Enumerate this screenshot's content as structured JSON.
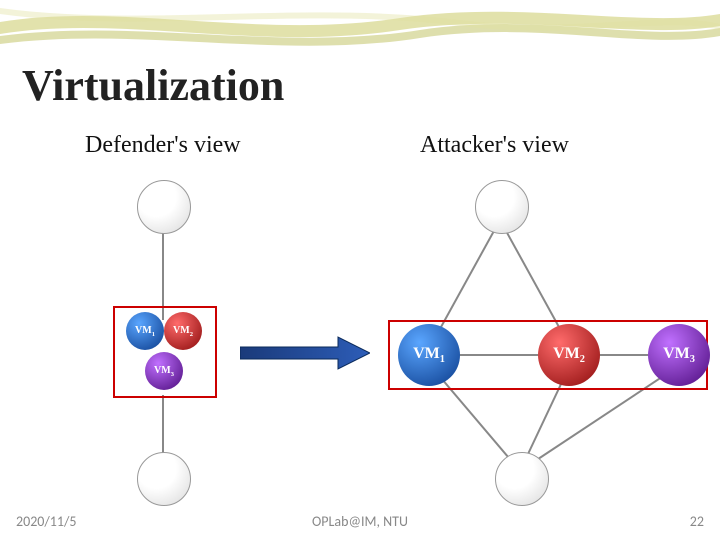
{
  "slide": {
    "title": "Virtualization",
    "defender_label": "Defender's view",
    "attacker_label": "Attacker's view"
  },
  "vms": {
    "vm1_html": "VM<sub>1</sub>",
    "vm2_html": "VM<sub>2</sub>",
    "vm3_html": "VM<sub>3</sub>"
  },
  "footer": {
    "date": "2020/11/5",
    "source": "OPLab@IM, NTU",
    "page": "22"
  },
  "colors": {
    "vm1": "#0a3a8a",
    "vm2": "#8a0a0a",
    "vm3": "#4a0a7a",
    "redbox": "#c00"
  }
}
